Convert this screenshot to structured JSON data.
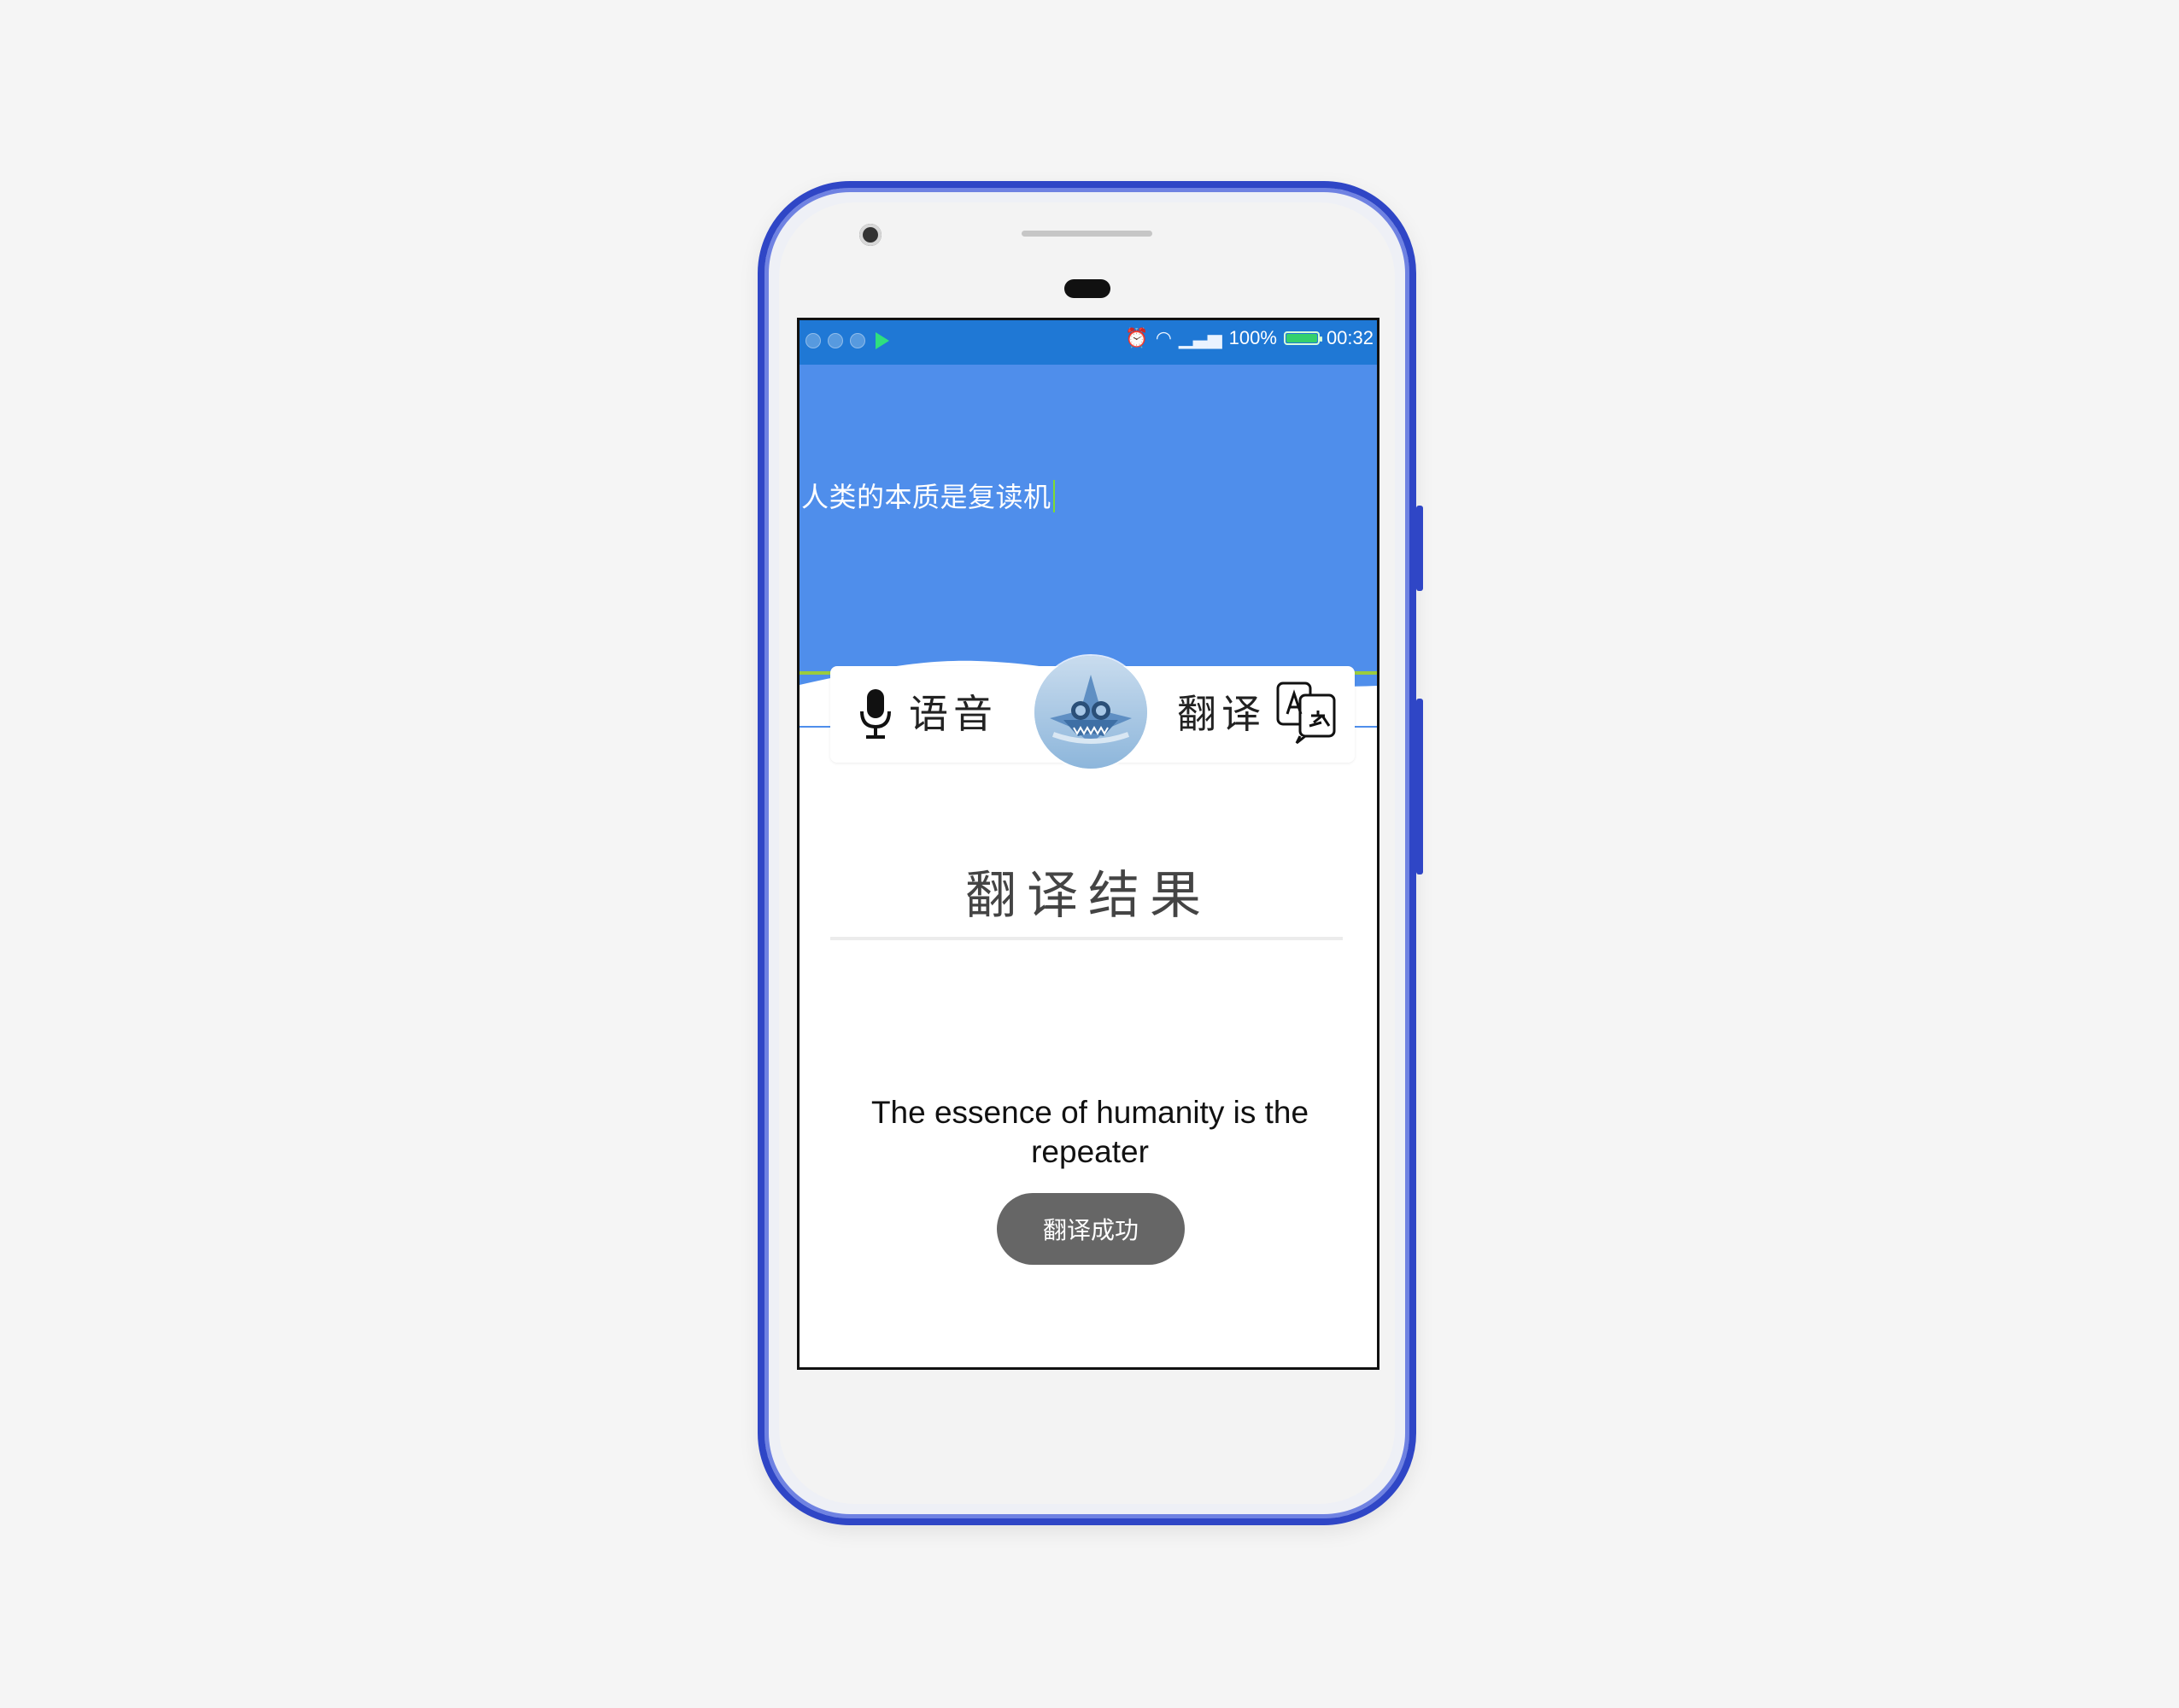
{
  "status_bar": {
    "battery_percent": "100%",
    "time": "00:32"
  },
  "input": {
    "text": "人类的本质是复读机"
  },
  "actions": {
    "voice_label": "语音",
    "translate_label": "翻译"
  },
  "result": {
    "title": "翻译结果",
    "text": "The essence of humanity is the repeater",
    "toast": "翻译成功"
  },
  "icons": {
    "mic": "microphone-icon",
    "translate": "translate-icon",
    "logo": "shark-logo-icon",
    "wifi": "wifi-icon",
    "signal": "signal-icon",
    "battery": "battery-icon",
    "alarm": "alarm-icon",
    "play_store": "play-store-icon"
  },
  "colors": {
    "phone_frame": "#2f46c6",
    "status_bar": "#1f78d5",
    "top_panel": "#4f8eeb",
    "input_underline": "#9bcb3d",
    "toast_bg": "#666666"
  }
}
